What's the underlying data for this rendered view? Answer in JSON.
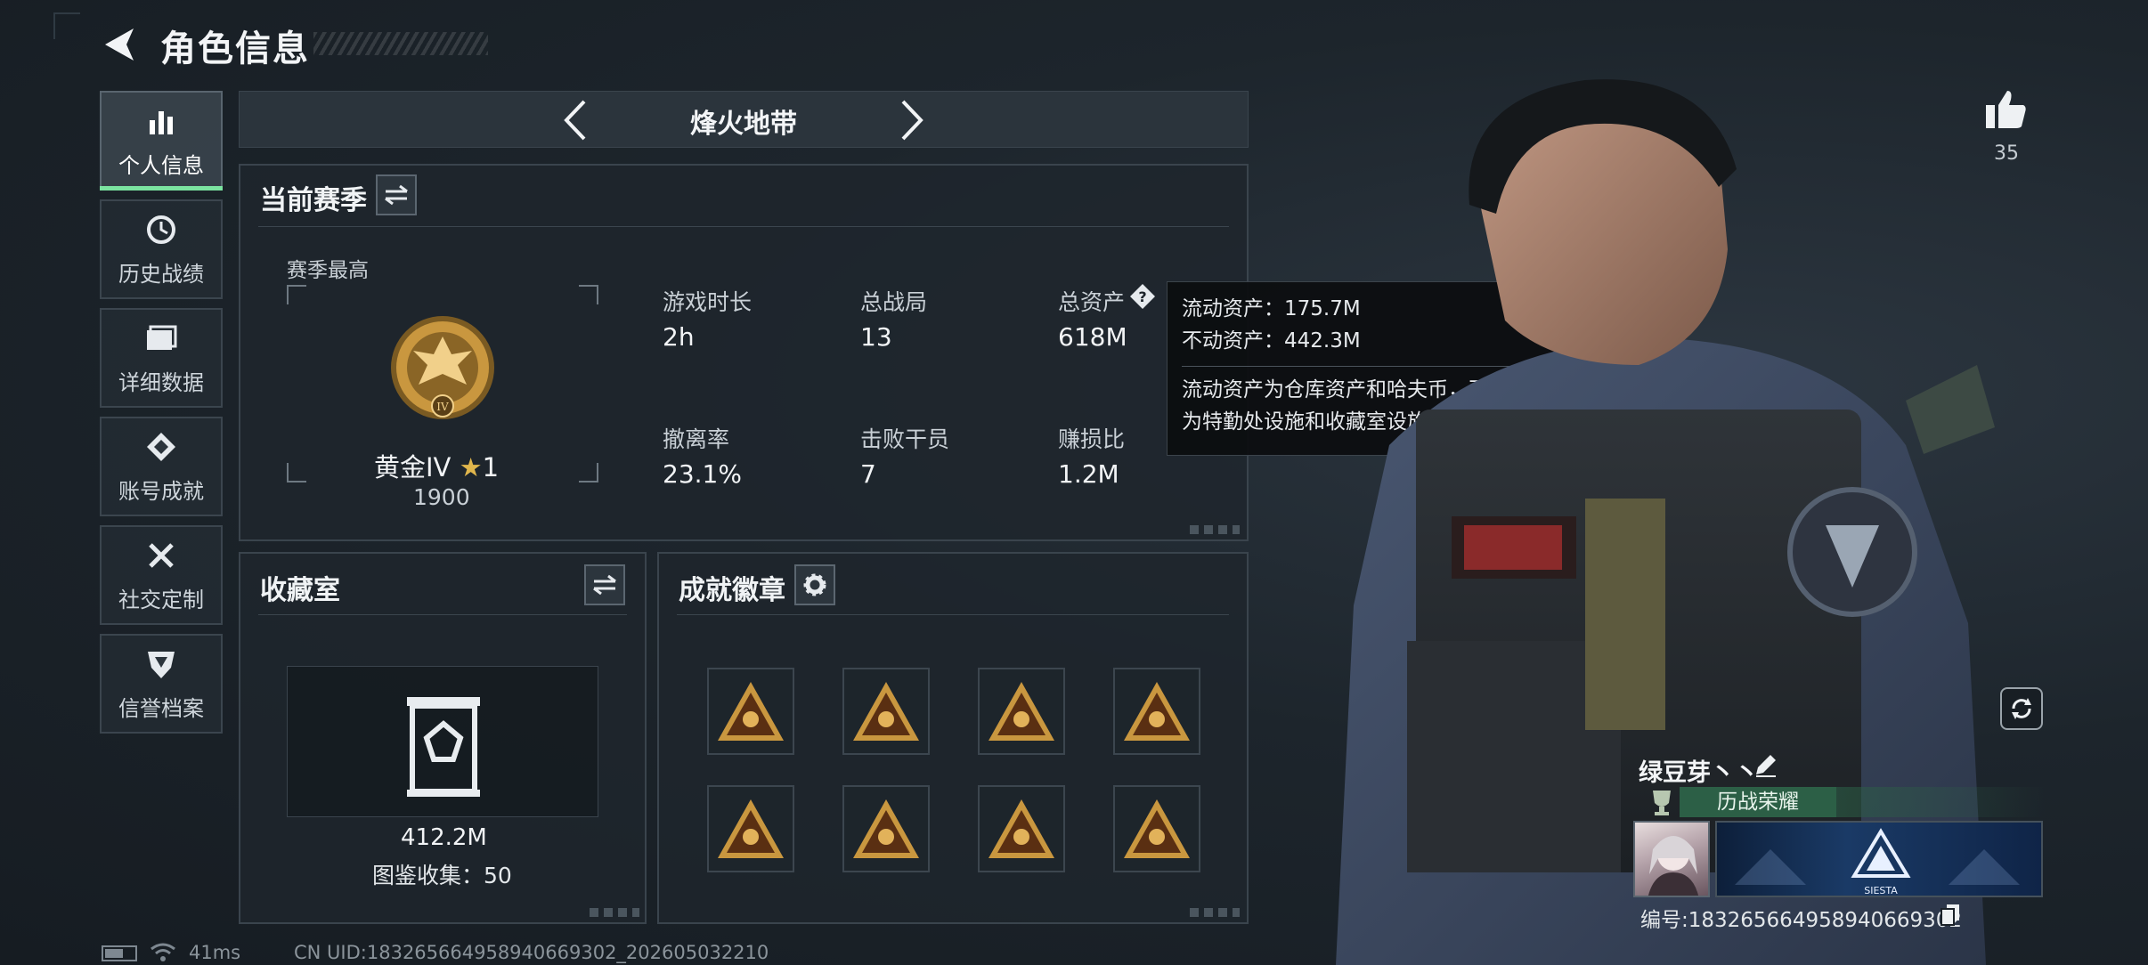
{
  "header": {
    "title": "角色信息"
  },
  "sidebar": {
    "items": [
      {
        "label": "个人信息",
        "icon": "bar-chart-icon",
        "active": true
      },
      {
        "label": "历史战绩",
        "icon": "history-icon",
        "active": false
      },
      {
        "label": "详细数据",
        "icon": "folder-icon",
        "active": false
      },
      {
        "label": "账号成就",
        "icon": "achievement-icon",
        "active": false
      },
      {
        "label": "社交定制",
        "icon": "tools-icon",
        "active": false
      },
      {
        "label": "信誉档案",
        "icon": "shield-icon",
        "active": false
      }
    ]
  },
  "mode": {
    "name": "烽火地带"
  },
  "season": {
    "title": "当前赛季",
    "best_label": "赛季最高",
    "rank_name": "黄金IV",
    "rank_stars": "1",
    "rank_points": "1900",
    "stats": [
      {
        "label": "游戏时长",
        "value": "2h"
      },
      {
        "label": "总战局",
        "value": "13"
      },
      {
        "label": "总资产",
        "value": "618M"
      },
      {
        "label": "撤离率",
        "value": "23.1%"
      },
      {
        "label": "击败干员",
        "value": "7"
      },
      {
        "label": "赚损比",
        "value": "1.2M"
      }
    ]
  },
  "tooltip": {
    "liquid": "流动资产：175.7M",
    "fixed": "不动资产：442.3M",
    "desc_1": "流动资产为仓库资产和哈夫币，不动资产",
    "desc_2": "为特勤处设施和收藏室设施"
  },
  "collection": {
    "title": "收藏室",
    "value": "412.2M",
    "count_text": "图鉴收集：50"
  },
  "achievements": {
    "title": "成就徽章",
    "badges": [
      "badge-1",
      "badge-2",
      "badge-3",
      "badge-4",
      "badge-5",
      "badge-6",
      "badge-7",
      "badge-8"
    ]
  },
  "profile": {
    "likes": "35",
    "nickname": "绿豆芽丶丶",
    "honor": "历战荣耀",
    "player_id": "编号:18326566495894066930​2",
    "banner_text": "SIESTA"
  },
  "footer": {
    "ping": "41ms",
    "uid": "CN UID:18326566495894066930​2_202605032210"
  },
  "colors": {
    "accent": "#7be3a0",
    "gold": "#c9973f",
    "honor": "#2c5f46"
  }
}
